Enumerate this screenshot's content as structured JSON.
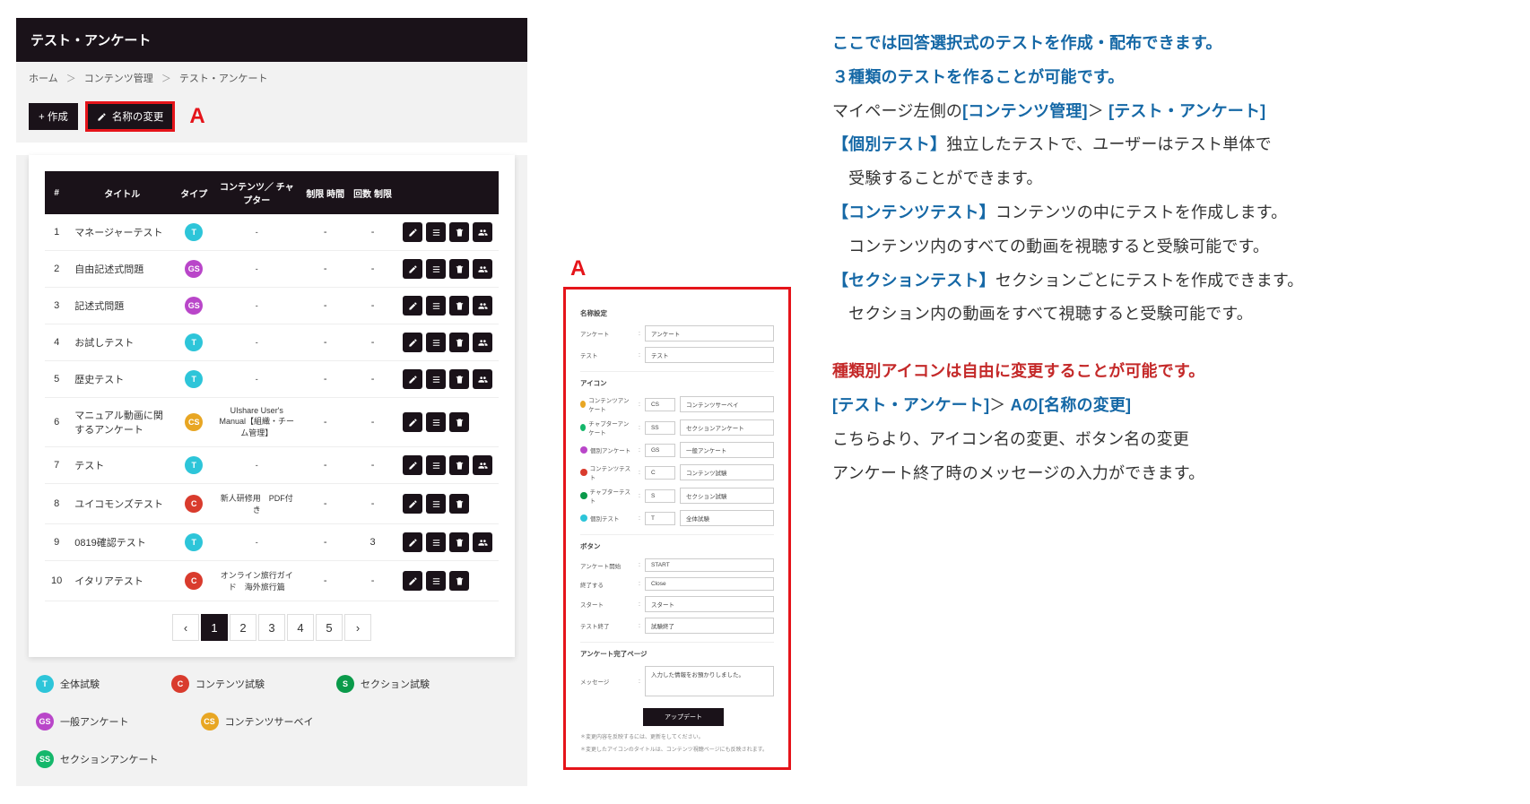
{
  "header": {
    "title": "テスト・アンケート"
  },
  "breadcrumb": {
    "home": "ホーム",
    "content_mgmt": "コンテンツ管理",
    "test": "テスト・アンケート"
  },
  "toolbar": {
    "create": "+ 作成",
    "rename": "名称の変更",
    "marker": "A"
  },
  "table": {
    "headers": {
      "num": "#",
      "title": "タイトル",
      "type": "タイプ",
      "content": "コンテンツ／\nチャプター",
      "time": "制限\n時間",
      "count": "回数\n制限"
    },
    "rows": [
      {
        "n": "1",
        "title": "マネージャーテスト",
        "type": "T",
        "tclass": "c-t",
        "content": "-",
        "time": "-",
        "count": "-",
        "users": true
      },
      {
        "n": "2",
        "title": "自由記述式問題",
        "type": "GS",
        "tclass": "c-gs",
        "content": "-",
        "time": "-",
        "count": "-",
        "users": true
      },
      {
        "n": "3",
        "title": "記述式問題",
        "type": "GS",
        "tclass": "c-gs",
        "content": "-",
        "time": "-",
        "count": "-",
        "users": true
      },
      {
        "n": "4",
        "title": "お試しテスト",
        "type": "T",
        "tclass": "c-t",
        "content": "-",
        "time": "-",
        "count": "-",
        "users": true
      },
      {
        "n": "5",
        "title": "歴史テスト",
        "type": "T",
        "tclass": "c-t",
        "content": "-",
        "time": "-",
        "count": "-",
        "users": true
      },
      {
        "n": "6",
        "title": "マニュアル動画に関するアンケート",
        "type": "CS",
        "tclass": "c-cs",
        "content": "UIshare User's Manual【組織・チーム管理】",
        "time": "-",
        "count": "-",
        "users": false
      },
      {
        "n": "7",
        "title": "テスト",
        "type": "T",
        "tclass": "c-t",
        "content": "-",
        "time": "-",
        "count": "-",
        "users": true
      },
      {
        "n": "8",
        "title": "ユイコモンズテスト",
        "type": "C",
        "tclass": "c-c",
        "content": "新人研修用　PDF付き",
        "time": "-",
        "count": "-",
        "users": false
      },
      {
        "n": "9",
        "title": "0819確認テスト",
        "type": "T",
        "tclass": "c-t",
        "content": "-",
        "time": "-",
        "count": "3",
        "users": true
      },
      {
        "n": "10",
        "title": "イタリアテスト",
        "type": "C",
        "tclass": "c-c",
        "content": "オンライン旅行ガイド　海外旅行篇",
        "time": "-",
        "count": "-",
        "users": false
      }
    ]
  },
  "pagination": {
    "prev": "‹",
    "pages": [
      "1",
      "2",
      "3",
      "4",
      "5"
    ],
    "next": "›",
    "current": "1"
  },
  "legend": [
    {
      "code": "T",
      "cls": "c-t",
      "label": "全体試験"
    },
    {
      "code": "C",
      "cls": "c-c",
      "label": "コンテンツ試験"
    },
    {
      "code": "S",
      "cls": "c-s",
      "label": "セクション試験"
    },
    {
      "code": "GS",
      "cls": "c-gs",
      "label": "一般アンケート"
    },
    {
      "code": "CS",
      "cls": "c-cs",
      "label": "コンテンツサーベイ"
    },
    {
      "code": "SS",
      "cls": "c-ss",
      "label": "セクションアンケート"
    }
  ],
  "form": {
    "marker": "A",
    "sect_name": "名称設定",
    "rows_name": [
      {
        "label": "アンケート",
        "value": "アンケート"
      },
      {
        "label": "テスト",
        "value": "テスト"
      }
    ],
    "sect_icon": "アイコン",
    "rows_icon": [
      {
        "dot": "#e8a623",
        "label": "コンテンツアンケート",
        "code": "CS",
        "value": "コンテンツサーベイ"
      },
      {
        "dot": "#15b76b",
        "label": "チャプターアンケート",
        "code": "SS",
        "value": "セクションアンケート"
      },
      {
        "dot": "#b946c9",
        "label": "個別アンケート",
        "code": "GS",
        "value": "一般アンケート"
      },
      {
        "dot": "#d93b2d",
        "label": "コンテンツテスト",
        "code": "C",
        "value": "コンテンツ試験"
      },
      {
        "dot": "#0a9a4a",
        "label": "チャプターテスト",
        "code": "S",
        "value": "セクション試験"
      },
      {
        "dot": "#2dc5d9",
        "label": "個別テスト",
        "code": "T",
        "value": "全体試験"
      }
    ],
    "sect_button": "ボタン",
    "rows_button": [
      {
        "label": "アンケート開始",
        "value": "START"
      },
      {
        "label": "終了する",
        "value": "Close"
      },
      {
        "label": "スタート",
        "value": "スタート"
      },
      {
        "label": "テスト終了",
        "value": "試験終了"
      }
    ],
    "sect_msg": "アンケート完了ページ",
    "row_msg": {
      "label": "メッセージ",
      "value": "入力した情報をお預かりしました。"
    },
    "update": "アップデート",
    "note1": "＊変更内容を反映するには、更新をしてください。",
    "note2": "＊変更したアイコンのタイトルは、コンテンツ視聴ページにも反映されます。"
  },
  "explain": {
    "l1": "ここでは回答選択式のテストを作成・配布できます。",
    "l2": "３種類のテストを作ることが可能です。",
    "l3a": "マイページ左側の",
    "l3b": "[コンテンツ管理]",
    "l3c": "＞",
    "l3d": "[テスト・アンケート]",
    "l4a": "【個別テスト】",
    "l4b": "独立したテストで、ユーザーはテスト単体で",
    "l5": "　受験することができます。",
    "l6a": "【コンテンツテスト】",
    "l6b": "コンテンツの中にテストを作成します。",
    "l7": "　コンテンツ内のすべての動画を視聴すると受験可能です。",
    "l8a": "【セクションテスト】",
    "l8b": "セクションごとにテストを作成できます。",
    "l9": "　セクション内の動画をすべて視聴すると受験可能です。",
    "l10": "種類別アイコンは自由に変更することが可能です。",
    "l11a": "[テスト・アンケート]",
    "l11b": "＞",
    "l11c": "Aの[名称の変更]",
    "l12": "こちらより、アイコン名の変更、ボタン名の変更",
    "l13": "アンケート終了時のメッセージの入力ができます。"
  }
}
